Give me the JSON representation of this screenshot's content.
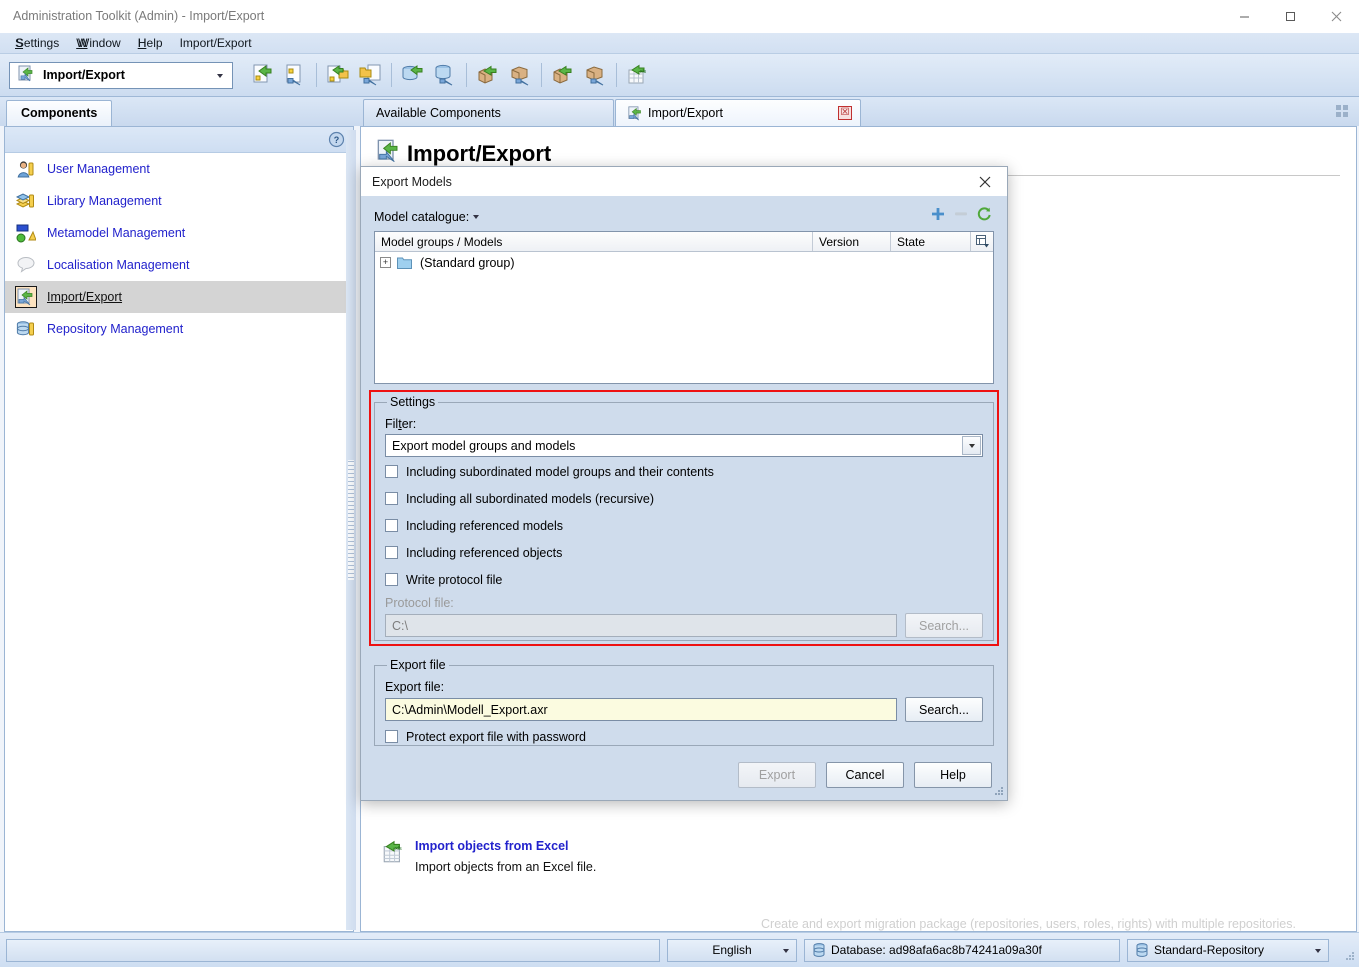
{
  "window": {
    "title": "Administration Toolkit (Admin) - Import/Export",
    "minimize_label": "—",
    "maximize_label": "□",
    "close_label": "✕"
  },
  "menubar": {
    "items": [
      {
        "label": "Settings",
        "mnemonic": "S"
      },
      {
        "label": "Window",
        "mnemonic": "W"
      },
      {
        "label": "Help",
        "mnemonic": "H"
      },
      {
        "label": "Import/Export",
        "mnemonic": ""
      }
    ]
  },
  "toolbar": {
    "component_selector": {
      "value": "Import/Export",
      "icon": "import-export-icon"
    },
    "buttons": [
      {
        "name": "import-model-icon",
        "tooltip": "Import model"
      },
      {
        "name": "export-model-icon",
        "tooltip": "Export model"
      },
      {
        "name": "import-model-group-icon",
        "tooltip": "Import model group"
      },
      {
        "name": "export-model-group-icon",
        "tooltip": "Export model group"
      },
      {
        "name": "import-database-icon",
        "tooltip": "Import database"
      },
      {
        "name": "export-database-icon",
        "tooltip": "Export database"
      },
      {
        "name": "import-package-icon",
        "tooltip": "Import package"
      },
      {
        "name": "export-package-icon",
        "tooltip": "Export package"
      },
      {
        "name": "import-migration-package-icon",
        "tooltip": "Import migration package"
      },
      {
        "name": "export-migration-package-icon",
        "tooltip": "Export migration package"
      },
      {
        "name": "import-excel-icon",
        "tooltip": "Import objects from Excel"
      }
    ]
  },
  "sidebar": {
    "tab_label": "Components",
    "help_icon": "help-icon",
    "items": [
      {
        "label": "User Management",
        "icon": "user-management-icon",
        "selected": false
      },
      {
        "label": "Library Management",
        "icon": "library-management-icon",
        "selected": false
      },
      {
        "label": "Metamodel Management",
        "icon": "metamodel-management-icon",
        "selected": false
      },
      {
        "label": "Localisation Management",
        "icon": "localisation-management-icon",
        "selected": false
      },
      {
        "label": "Import/Export",
        "icon": "import-export-icon",
        "selected": true
      },
      {
        "label": "Repository Management",
        "icon": "repository-management-icon",
        "selected": false
      }
    ]
  },
  "document": {
    "tabs": [
      {
        "label": "Available Components",
        "active": false,
        "closable": false
      },
      {
        "label": "Import/Export",
        "active": true,
        "closable": true,
        "icon": "import-export-icon",
        "close_label": "☒"
      }
    ],
    "grid_icon": "grid-view-icon",
    "page_title": "Import/Export",
    "page_title_icon": "import-export-icon",
    "obscured_entry_text": "Create and export migration package (repositories, users, roles, rights) with multiple repositories.",
    "entries": [
      {
        "link": "Import objects from Excel",
        "description": "Import objects from an Excel file.",
        "icon": "import-excel-icon"
      }
    ]
  },
  "dialog": {
    "title": "Export Models",
    "close_label": "✕",
    "catalogue": {
      "label": "Model catalogue:",
      "add_icon": "plus-icon",
      "remove_icon": "minus-icon",
      "refresh_icon": "refresh-icon"
    },
    "tree": {
      "columns": [
        "Model groups / Models",
        "Version",
        "State"
      ],
      "column_chooser_icon": "column-chooser-icon",
      "rows": [
        {
          "label": "(Standard group)",
          "version": "",
          "state": "",
          "expander": "+",
          "icon": "folder-icon"
        }
      ]
    },
    "settings": {
      "legend": "Settings",
      "filter_label": "Filter:",
      "filter_value": "Export model groups and models",
      "checkboxes": [
        {
          "label": "Including subordinated model groups and their contents",
          "checked": false
        },
        {
          "label": "Including all subordinated models (recursive)",
          "checked": false
        },
        {
          "label": "Including referenced models",
          "checked": false
        },
        {
          "label": "Including referenced objects",
          "checked": false
        },
        {
          "label": "Write protocol file",
          "checked": false
        }
      ],
      "protocol_file_label": "Protocol file:",
      "protocol_file_value": "C:\\",
      "protocol_search_label": "Search...",
      "protocol_disabled": true
    },
    "export_file": {
      "legend": "Export file",
      "label": "Export file:",
      "value": "C:\\Admin\\Modell_Export.axr",
      "search_label": "Search...",
      "protect_checkbox": {
        "label": "Protect export file with password",
        "checked": false
      }
    },
    "buttons": [
      {
        "label": "Export",
        "disabled": true,
        "name": "export-button"
      },
      {
        "label": "Cancel",
        "disabled": false,
        "name": "cancel-button"
      },
      {
        "label": "Help",
        "disabled": false,
        "name": "help-button"
      }
    ],
    "highlight_color": "#ee1111"
  },
  "statusbar": {
    "message": "",
    "language": "English",
    "database": "Database: ad98afa6ac8b74241a09a30f",
    "database_icon": "database-icon",
    "repository": "Standard-Repository",
    "repository_icon": "database-icon"
  }
}
